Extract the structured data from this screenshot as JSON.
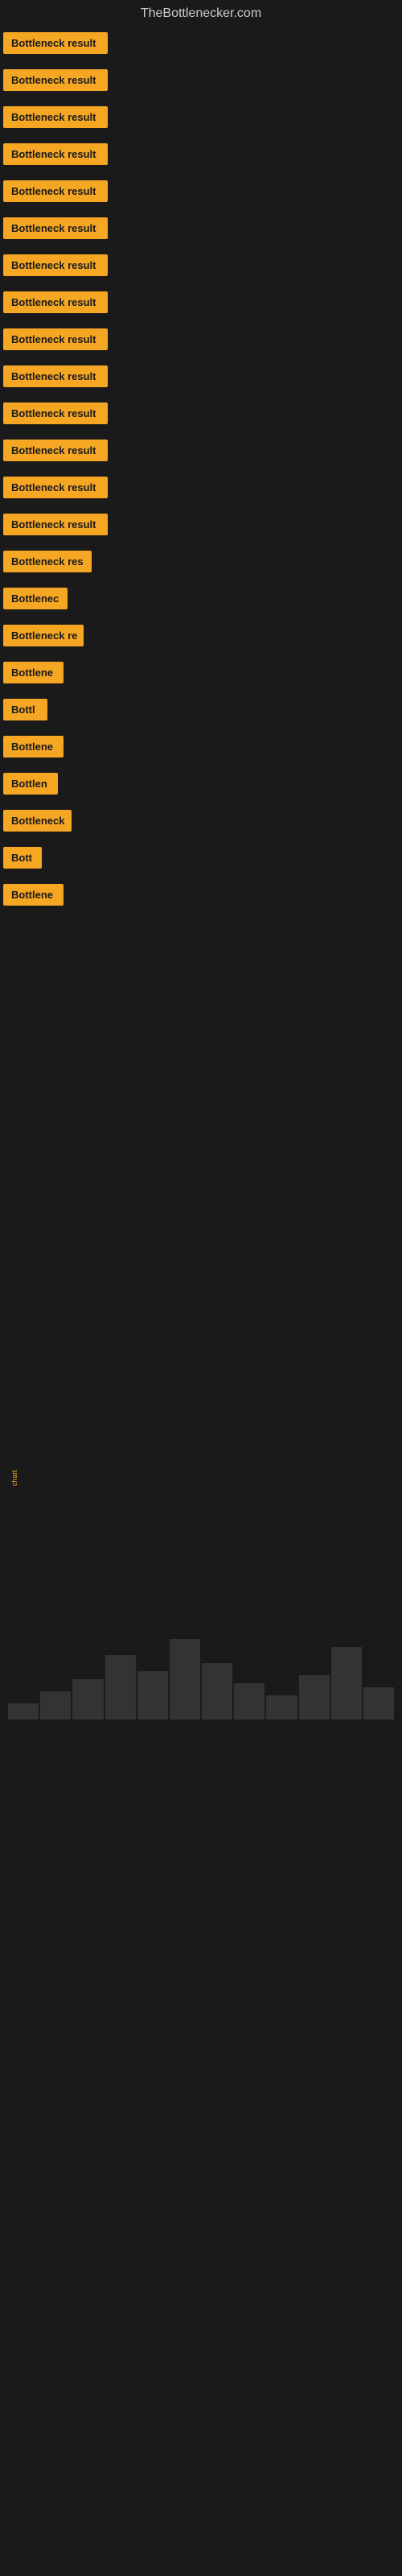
{
  "site": {
    "title": "TheBottlenecker.com"
  },
  "colors": {
    "accent": "#f5a623",
    "background": "#1a1a1a",
    "text_dark": "#1a1a1a",
    "text_light": "#cccccc"
  },
  "items": [
    {
      "label": "Bottleneck result",
      "width": 130
    },
    {
      "label": "Bottleneck result",
      "width": 130
    },
    {
      "label": "Bottleneck result",
      "width": 130
    },
    {
      "label": "Bottleneck result",
      "width": 130
    },
    {
      "label": "Bottleneck result",
      "width": 130
    },
    {
      "label": "Bottleneck result",
      "width": 130
    },
    {
      "label": "Bottleneck result",
      "width": 130
    },
    {
      "label": "Bottleneck result",
      "width": 130
    },
    {
      "label": "Bottleneck result",
      "width": 130
    },
    {
      "label": "Bottleneck result",
      "width": 130
    },
    {
      "label": "Bottleneck result",
      "width": 130
    },
    {
      "label": "Bottleneck result",
      "width": 130
    },
    {
      "label": "Bottleneck result",
      "width": 130
    },
    {
      "label": "Bottleneck result",
      "width": 130
    },
    {
      "label": "Bottleneck res",
      "width": 110
    },
    {
      "label": "Bottlenec",
      "width": 80
    },
    {
      "label": "Bottleneck re",
      "width": 100
    },
    {
      "label": "Bottlene",
      "width": 75
    },
    {
      "label": "Bottl",
      "width": 55
    },
    {
      "label": "Bottlene",
      "width": 75
    },
    {
      "label": "Bottlen",
      "width": 68
    },
    {
      "label": "Bottleneck",
      "width": 85
    },
    {
      "label": "Bott",
      "width": 48
    },
    {
      "label": "Bottlene",
      "width": 75
    }
  ],
  "bottom": {
    "label": "chart"
  }
}
